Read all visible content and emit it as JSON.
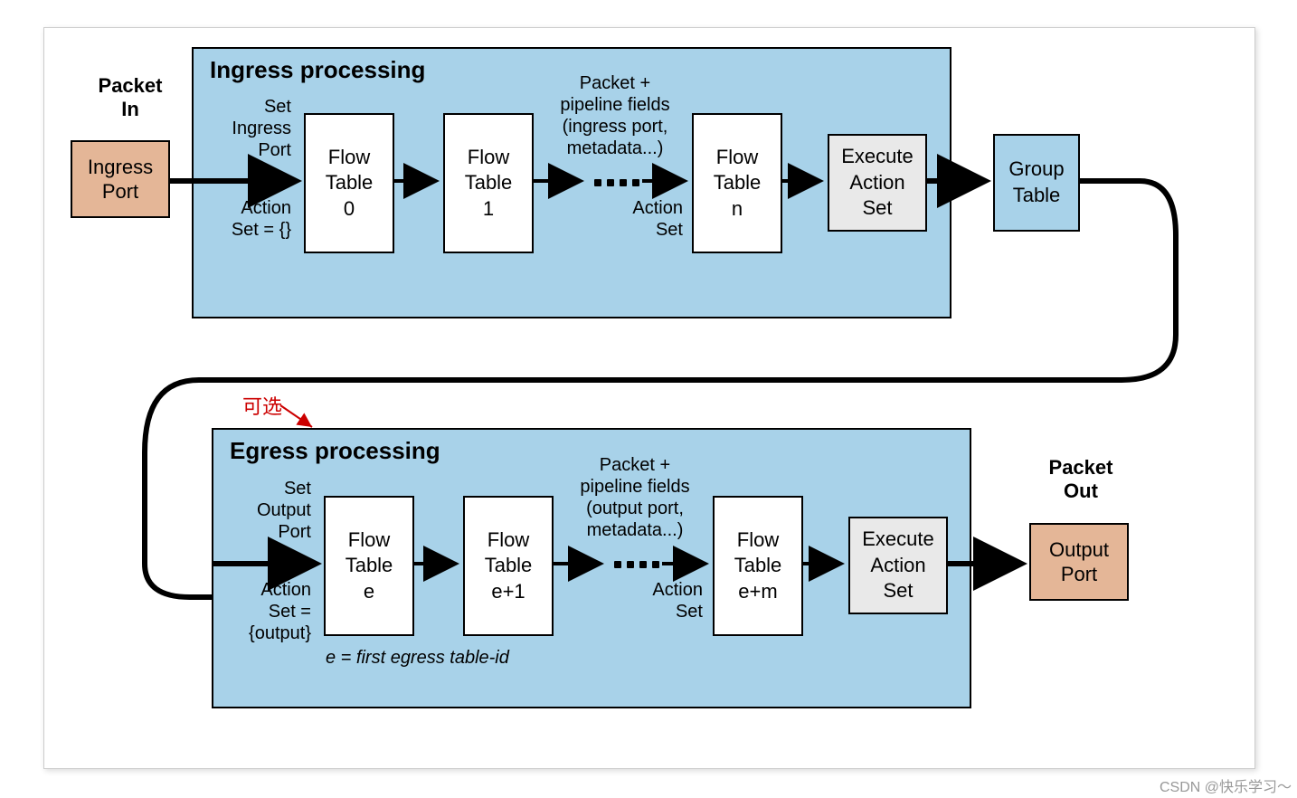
{
  "packet_in_label": "Packet\nIn",
  "packet_out_label": "Packet\nOut",
  "ingress_port": "Ingress\nPort",
  "output_port": "Output\nPort",
  "ingress_title": "Ingress processing",
  "egress_title": "Egress processing",
  "flow_tables_ingress": [
    "Flow\nTable\n0",
    "Flow\nTable\n1",
    "Flow\nTable\nn"
  ],
  "flow_tables_egress": [
    "Flow\nTable\ne",
    "Flow\nTable\ne+1",
    "Flow\nTable\ne+m"
  ],
  "exec_action_set": "Execute\nAction\nSet",
  "group_table": "Group\nTable",
  "anno_ingress_left_top": "Set\nIngress\nPort",
  "anno_ingress_left_bot": "Action\nSet = {}",
  "anno_ingress_mid_top": "Packet +\npipeline fields\n(ingress port,\nmetadata...)",
  "anno_ingress_mid_bot": "Action\nSet",
  "anno_egress_left_top": "Set\nOutput\nPort",
  "anno_egress_left_bot": "Action\nSet =\n{output}",
  "anno_egress_mid_top": "Packet +\npipeline fields\n(output port,\nmetadata...)",
  "anno_egress_mid_bot": "Action\nSet",
  "optional_label": "可选",
  "footnote": "e = first egress table-id",
  "watermark": "CSDN @快乐学习～"
}
